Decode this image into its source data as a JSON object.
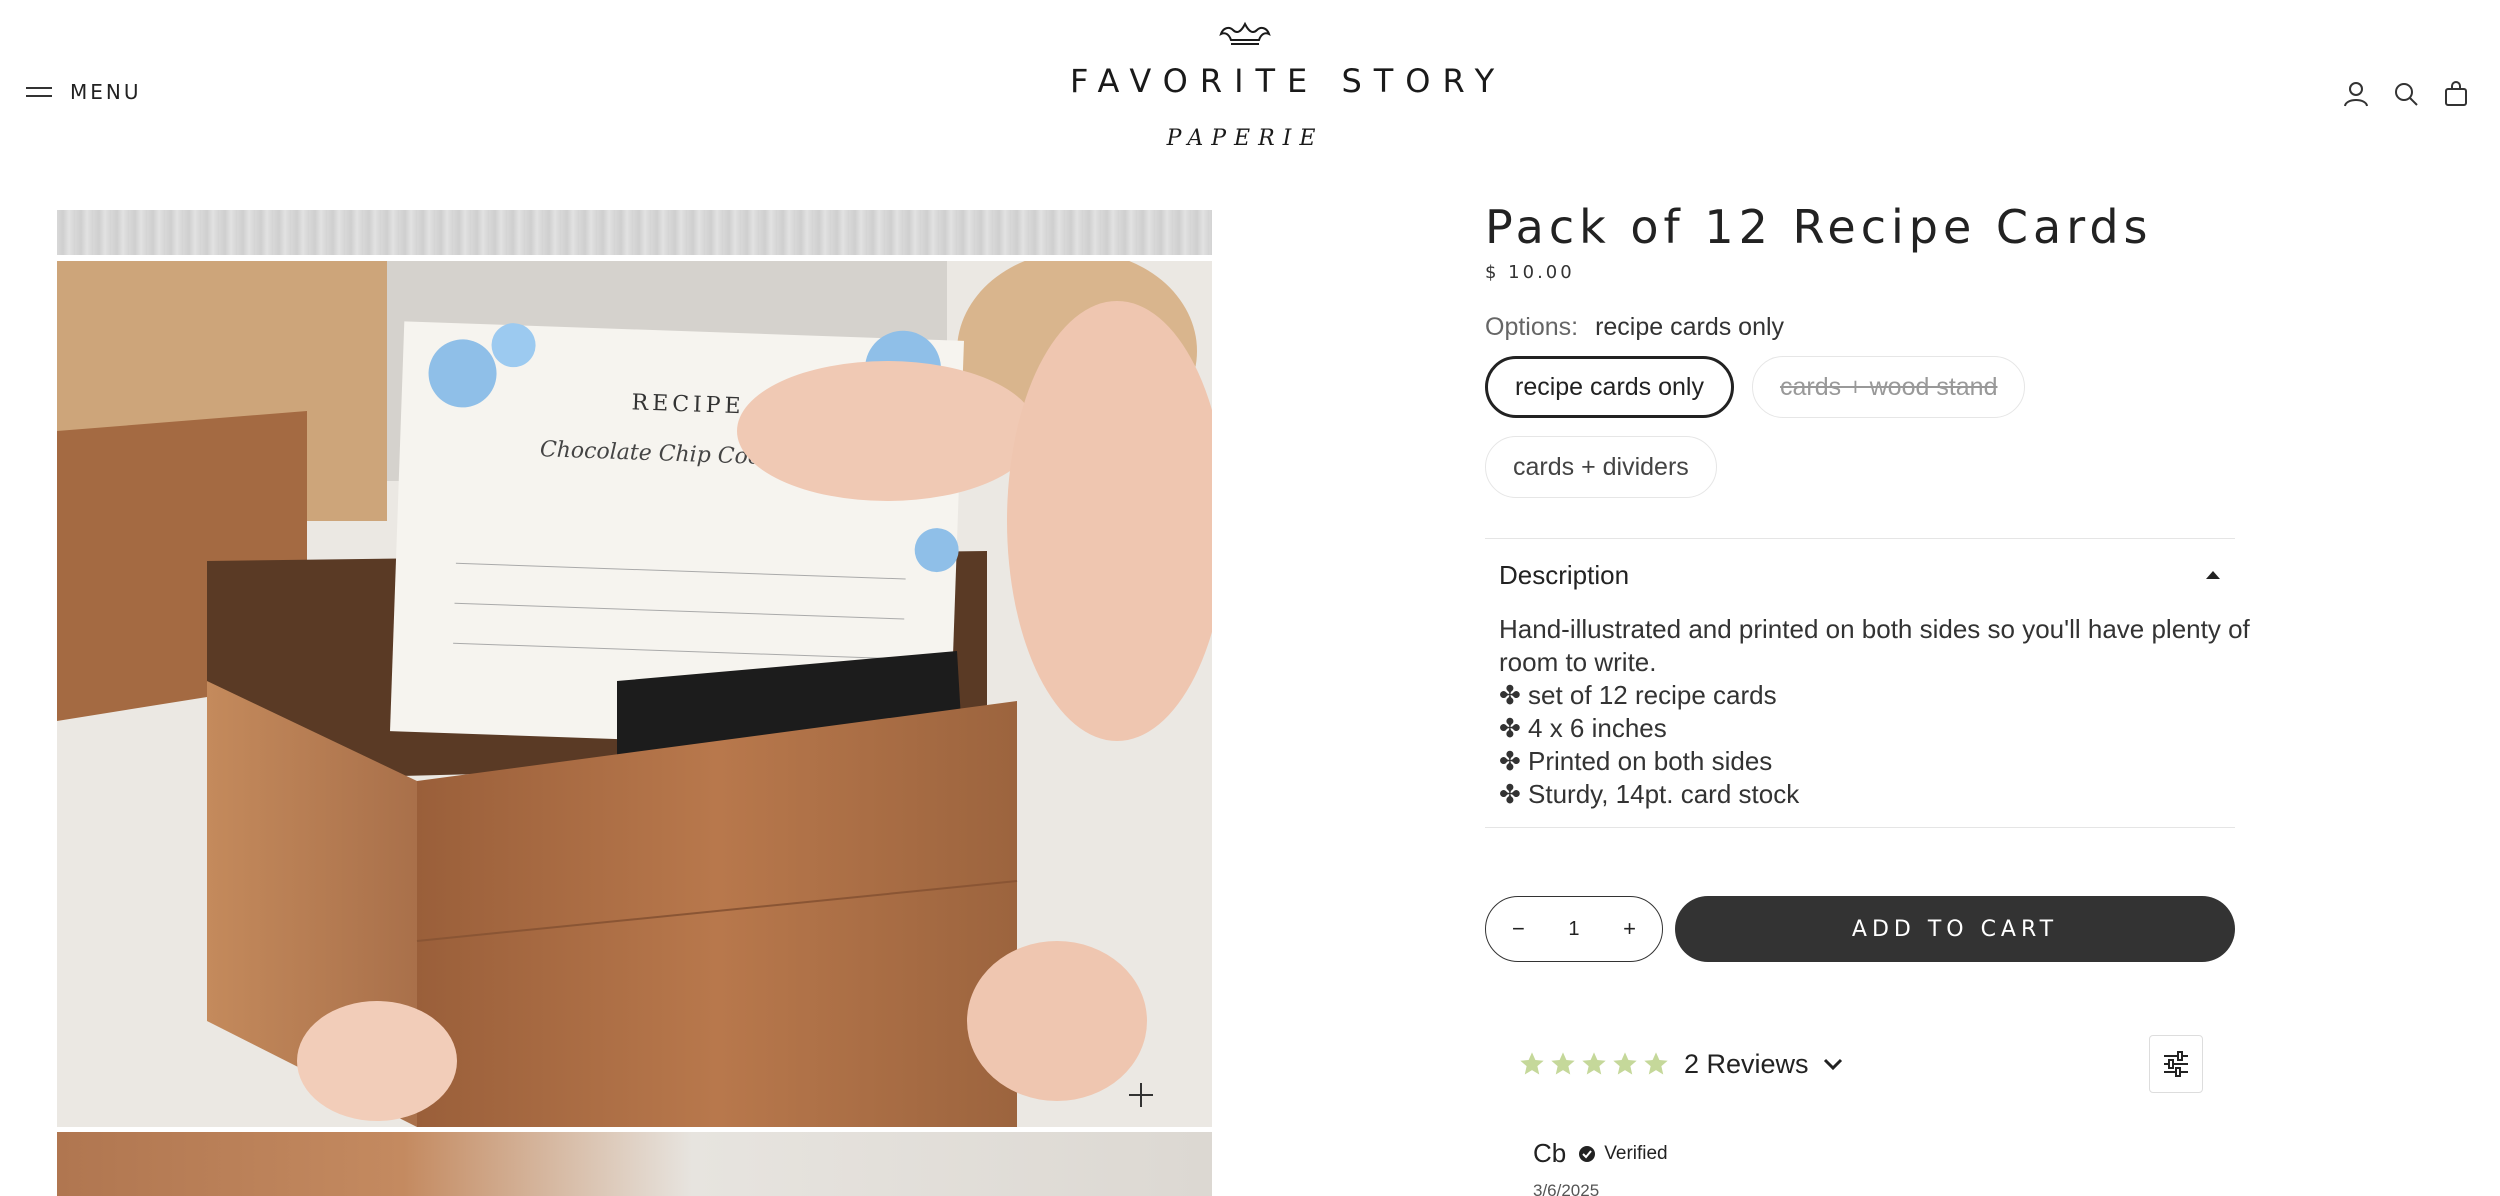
{
  "header": {
    "menu_label": "MENU",
    "logo_main": "FAVORITE STORY",
    "logo_sub": "PAPERIE",
    "icons": [
      "account-icon",
      "search-icon",
      "cart-icon"
    ]
  },
  "product": {
    "title": "Pack of 12 Recipe Cards",
    "price": "$ 10.00",
    "options_label": "Options:",
    "selected_option": "recipe cards only",
    "options": [
      {
        "label": "recipe cards only",
        "state": "selected"
      },
      {
        "label": "cards + wood stand",
        "state": "unavailable"
      },
      {
        "label": "cards + dividers",
        "state": "available"
      }
    ],
    "description": {
      "heading": "Description",
      "lines": [
        "Hand-illustrated and printed on both sides so you'll have plenty of",
        "room to write.",
        "✤ set of 12 recipe cards",
        "✤ 4 x 6 inches",
        "✤ Printed on both sides",
        "✤ Sturdy, 14pt. card stock"
      ]
    },
    "quantity": {
      "minus": "−",
      "value": "1",
      "plus": "+"
    },
    "add_to_cart": "ADD TO CART"
  },
  "reviews": {
    "rating": 5,
    "star_color": "#c5d89a",
    "label": "2 Reviews",
    "first_review": {
      "author": "Cb",
      "verified": "Verified",
      "date": "3/6/2025"
    }
  },
  "colors": {
    "dark_button": "#333333",
    "text": "#222222"
  }
}
